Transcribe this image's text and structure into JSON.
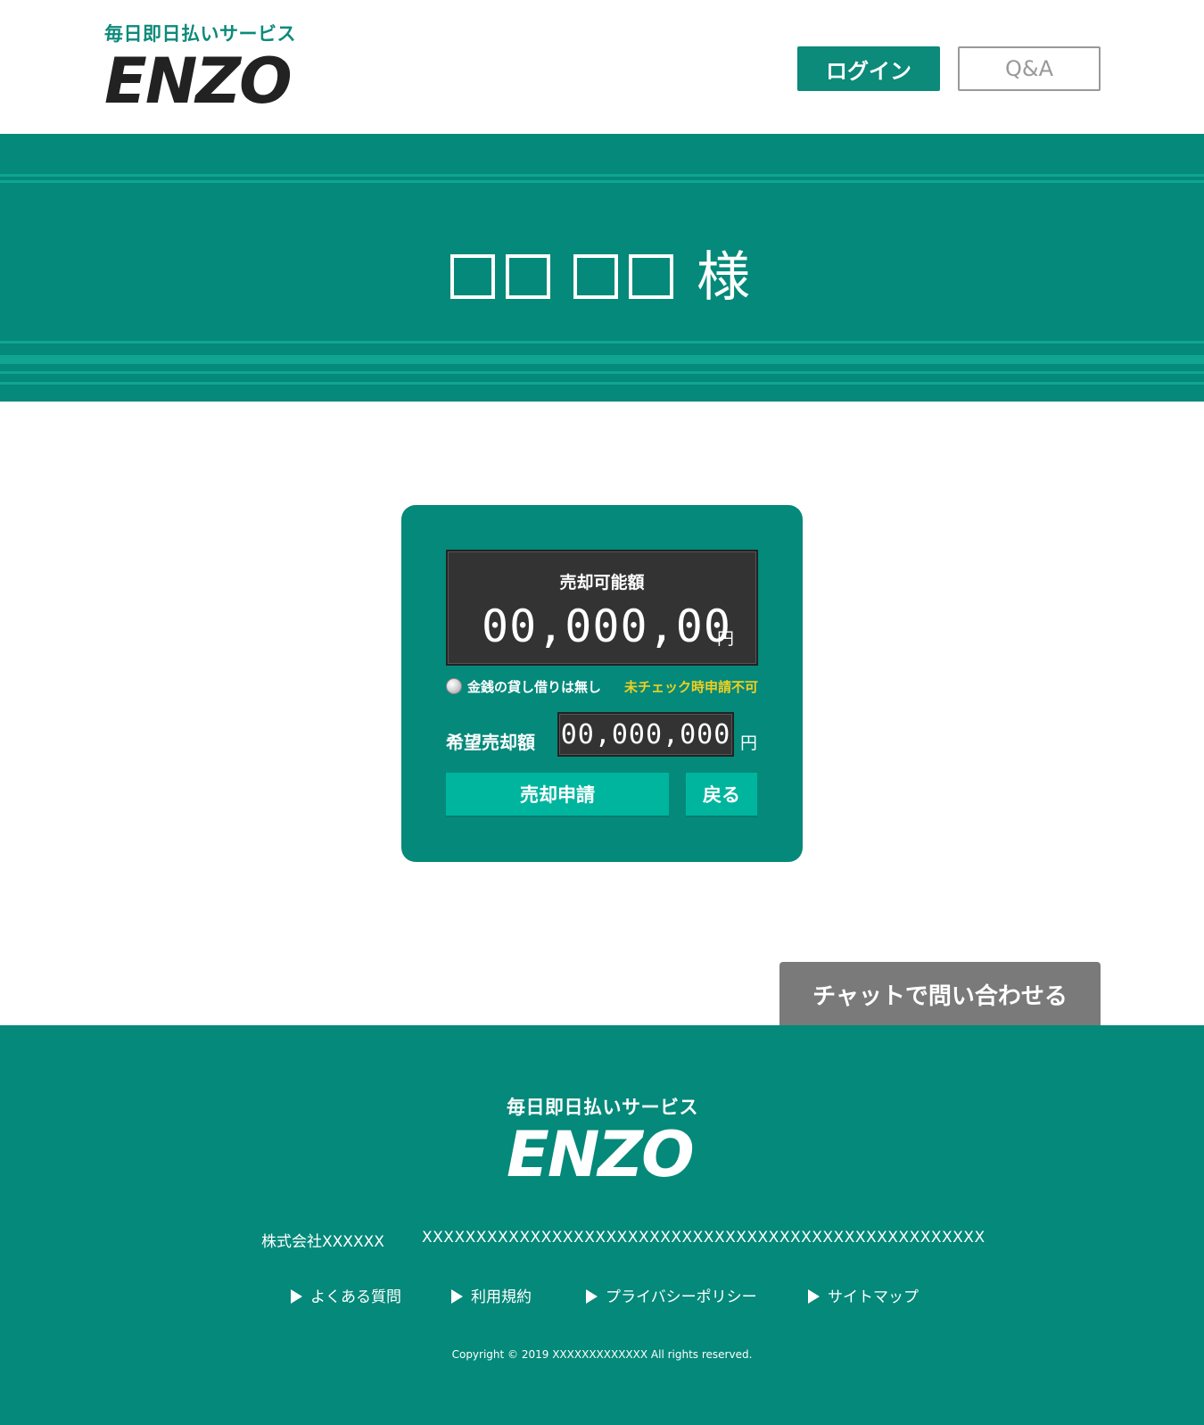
{
  "header": {
    "tagline": "毎日即日払いサービス",
    "brand": "ENZO",
    "login_label": "ログイン",
    "qa_label": "Q&A"
  },
  "hero": {
    "name_suffix": "様"
  },
  "card": {
    "available_label": "売却可能額",
    "available_value": "00,000,00",
    "available_unit": "円",
    "no_loan_label": "金銭の貸し借りは無し",
    "unchecked_warning": "未チェック時申請不可",
    "desired_label": "希望売却額",
    "desired_value": "00,000,000",
    "desired_unit": "円",
    "sell_button": "売却申請",
    "back_button": "戻る"
  },
  "chat_button": "チャットで問い合わせる",
  "footer": {
    "tagline": "毎日即日払いサービス",
    "brand": "ENZO",
    "company": "株式会社XXXXXX",
    "address": "XXXXXXXXXXXXXXXXXXXXXXXXXXXXXXXXXXXXXXXXXXXXXXXXXXXX",
    "links": [
      "よくある質問",
      "利用規約",
      "プライバシーポリシー",
      "サイトマップ"
    ],
    "copyright": "Copyright © 2019 XXXXXXXXXXXXX All rights reserved."
  },
  "colors": {
    "brand_green": "#04897a",
    "button_green": "#00b59e",
    "warning_yellow": "#f0d020",
    "display_dark": "#333333",
    "chat_gray": "#7a7a7a"
  }
}
